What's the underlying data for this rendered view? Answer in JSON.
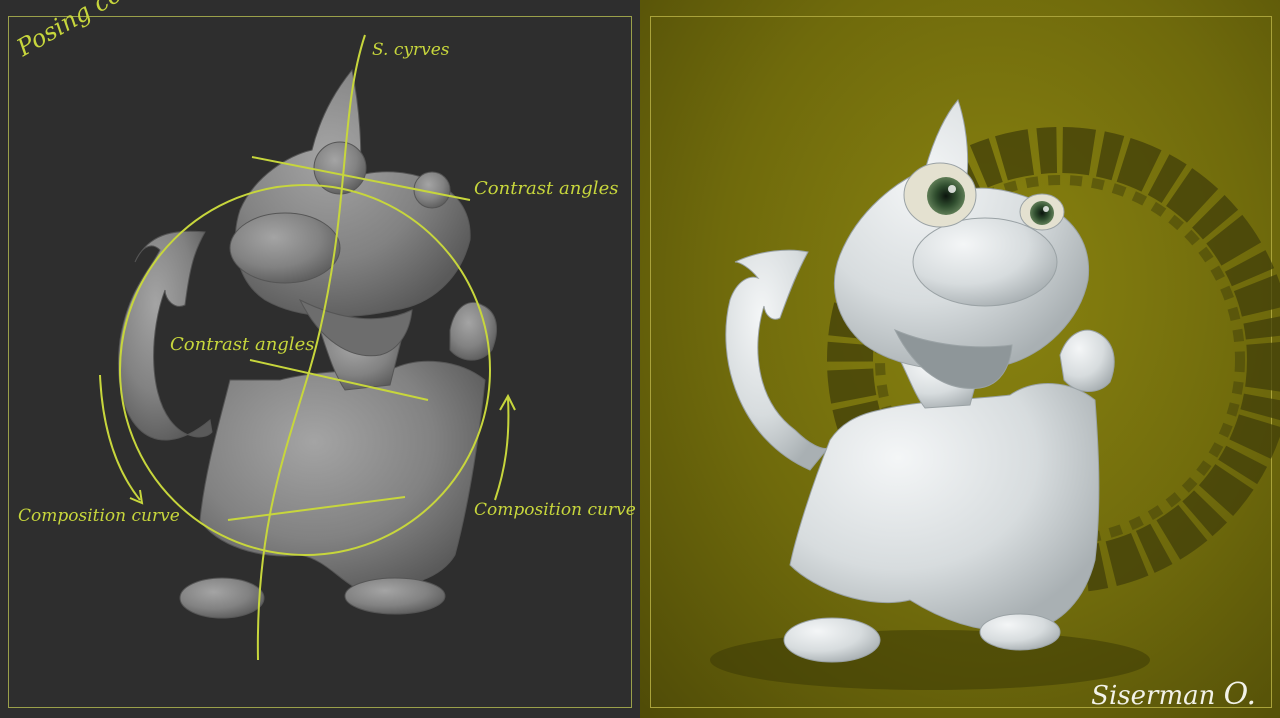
{
  "left_panel": {
    "title": "Posing concept",
    "notes": {
      "s_curves": "S. cyrves",
      "contrast_angles_top": "Contrast angles",
      "contrast_angles_mid": "Contrast angles",
      "composition_left": "Composition curve",
      "composition_right": "Composition curve"
    },
    "colors": {
      "background": "#2e2e2e",
      "annotation": "#c7d63c"
    }
  },
  "right_panel": {
    "signature_name": "Siserman",
    "signature_initial": "O.",
    "colors": {
      "background": "#6f6a0c"
    }
  }
}
